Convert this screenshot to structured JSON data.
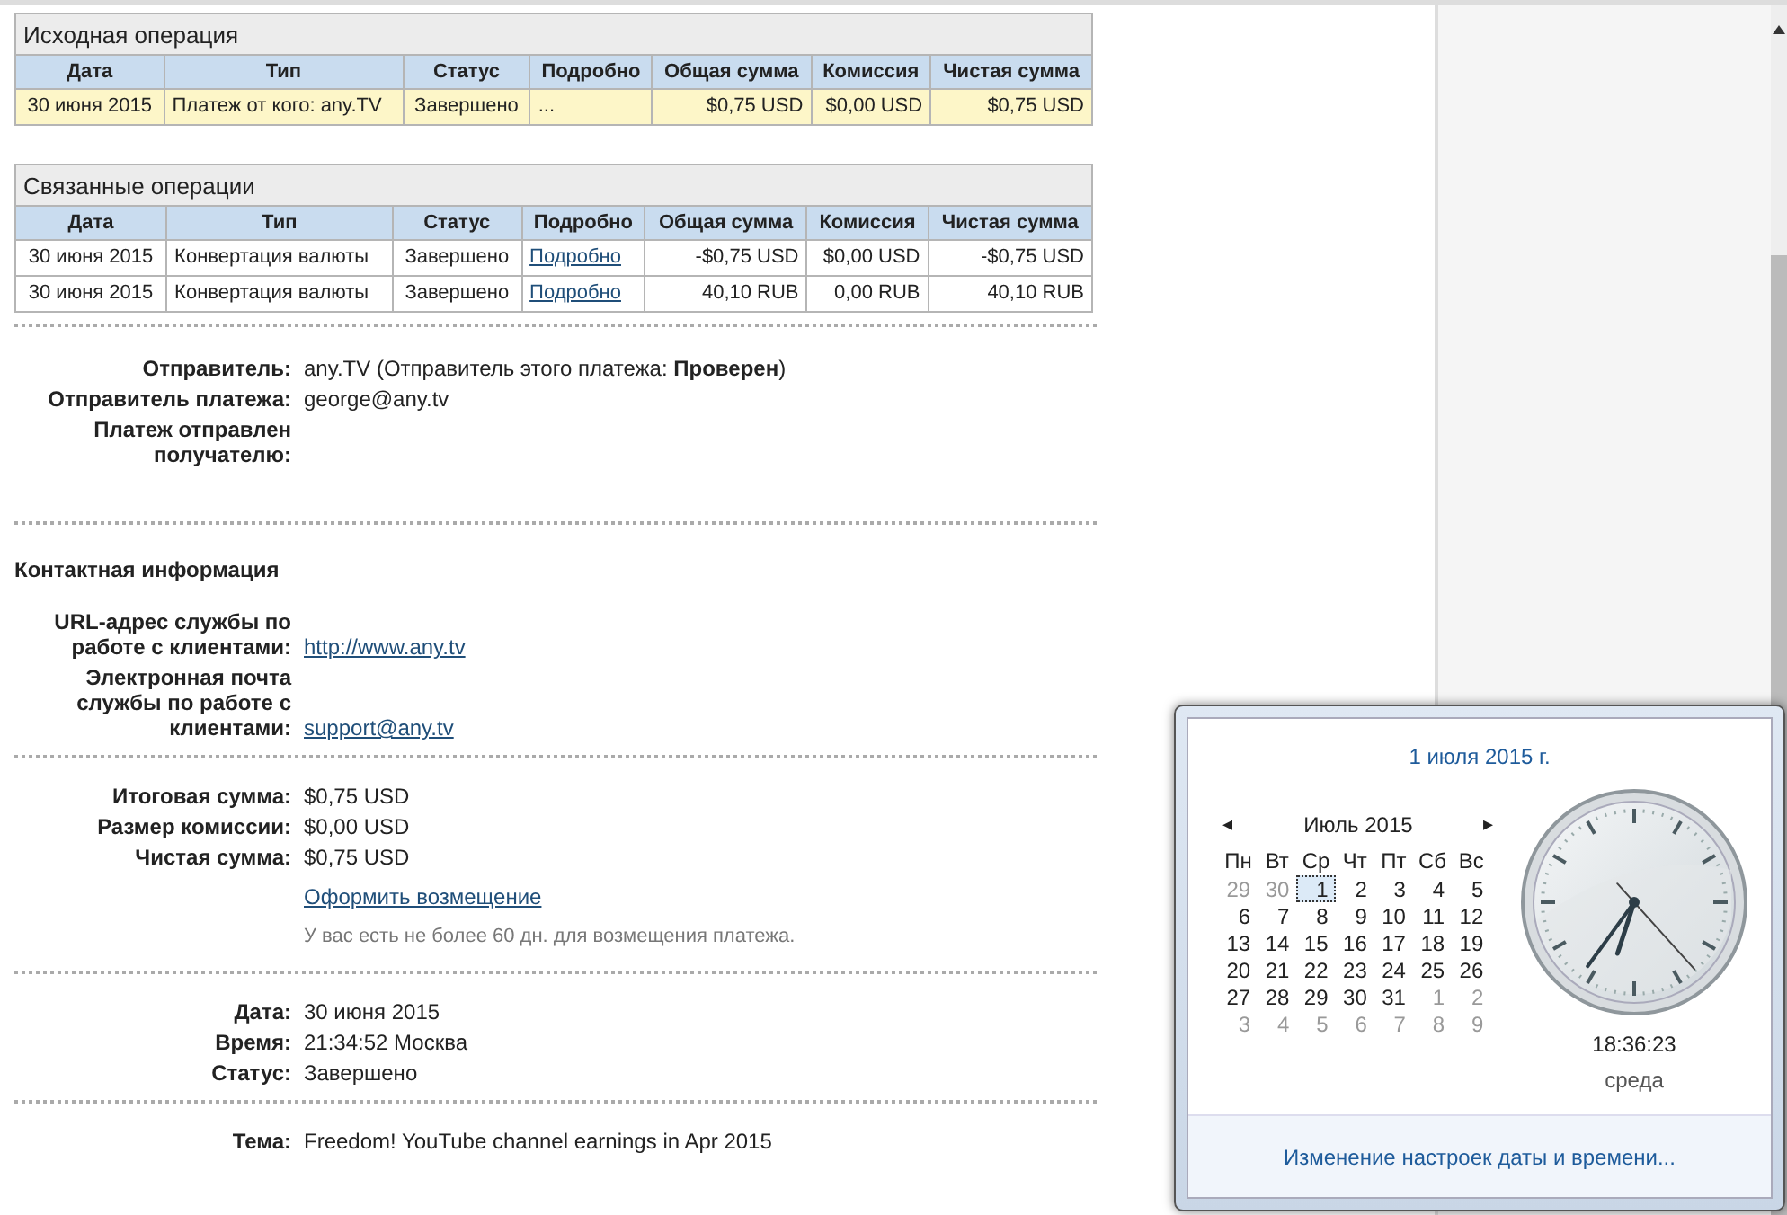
{
  "original_operation": {
    "title": "Исходная операция",
    "columns": [
      "Дата",
      "Тип",
      "Статус",
      "Подробно",
      "Общая сумма",
      "Комиссия",
      "Чистая сумма"
    ],
    "rows": [
      {
        "highlighted": true,
        "details_link": false,
        "cells": [
          "30 июня 2015",
          "Платеж от кого: any.TV",
          "Завершено",
          "...",
          "$0,75 USD",
          "$0,00 USD",
          "$0,75 USD"
        ]
      }
    ]
  },
  "related_operations": {
    "title": "Связанные операции",
    "columns": [
      "Дата",
      "Тип",
      "Статус",
      "Подробно",
      "Общая сумма",
      "Комиссия",
      "Чистая сумма"
    ],
    "rows": [
      {
        "highlighted": false,
        "details_link": true,
        "cells": [
          "30 июня 2015",
          "Конвертация валюты",
          "Завершено",
          "Подробно",
          "-$0,75 USD",
          "$0,00 USD",
          "-$0,75 USD"
        ]
      },
      {
        "highlighted": false,
        "details_link": true,
        "cells": [
          "30 июня 2015",
          "Конвертация валюты",
          "Завершено",
          "Подробно",
          "40,10 RUB",
          "0,00 RUB",
          "40,10 RUB"
        ]
      }
    ]
  },
  "sections": [
    {
      "fields": [
        {
          "kind": "text",
          "label": "Отправитель:",
          "value": "any.TV (Отправитель этого платежа: **Проверен**)"
        },
        {
          "kind": "text",
          "label": "Отправитель платежа:",
          "value": "george@any.tv"
        },
        {
          "kind": "text",
          "label": "Платеж отправлен получателю:"
        }
      ]
    },
    {
      "heading": "Контактная информация",
      "fields": [
        {
          "kind": "link",
          "label": "URL-адрес службы по работе с клиентами:",
          "value": "http://www.any.tv"
        },
        {
          "kind": "link",
          "label": "Электронная почта службы по работе с клиентами:",
          "value": "support@any.tv"
        }
      ]
    },
    {
      "fields": [
        {
          "kind": "text",
          "label": "Итоговая сумма:",
          "value": "$0,75 USD"
        },
        {
          "kind": "text",
          "label": "Размер комиссии:",
          "value": "$0,00 USD"
        },
        {
          "kind": "text",
          "label": "Чистая сумма:",
          "value": "$0,75 USD"
        },
        {
          "kind": "action",
          "value": "Оформить возмещение"
        },
        {
          "kind": "note",
          "value": "У вас есть не более 60 дн. для возмещения платежа."
        }
      ]
    },
    {
      "fields": [
        {
          "kind": "text",
          "label": "Дата:",
          "value": "30 июня 2015"
        },
        {
          "kind": "text",
          "label": "Время:",
          "value": "21:34:52 Москва"
        },
        {
          "kind": "text",
          "label": "Статус:",
          "value": "Завершено"
        }
      ]
    },
    {
      "fields": [
        {
          "kind": "text",
          "label": "Тема:",
          "value": "Freedom! YouTube channel earnings in Apr 2015"
        }
      ]
    }
  ],
  "calendar_popup": {
    "date_heading": "1 июля 2015 г.",
    "prev": "◂",
    "month": "Июль 2015",
    "next": "▸",
    "weekdays": [
      "Пн",
      "Вт",
      "Ср",
      "Чт",
      "Пт",
      "Сб",
      "Вс"
    ],
    "weeks": [
      [
        {
          "day": "29",
          "other_month": true,
          "selected": false
        },
        {
          "day": "30",
          "other_month": true,
          "selected": false
        },
        {
          "day": "1",
          "other_month": false,
          "selected": true
        },
        {
          "day": "2",
          "other_month": false,
          "selected": false
        },
        {
          "day": "3",
          "other_month": false,
          "selected": false
        },
        {
          "day": "4",
          "other_month": false,
          "selected": false
        },
        {
          "day": "5",
          "other_month": false,
          "selected": false
        }
      ],
      [
        {
          "day": "6",
          "other_month": false,
          "selected": false
        },
        {
          "day": "7",
          "other_month": false,
          "selected": false
        },
        {
          "day": "8",
          "other_month": false,
          "selected": false
        },
        {
          "day": "9",
          "other_month": false,
          "selected": false
        },
        {
          "day": "10",
          "other_month": false,
          "selected": false
        },
        {
          "day": "11",
          "other_month": false,
          "selected": false
        },
        {
          "day": "12",
          "other_month": false,
          "selected": false
        }
      ],
      [
        {
          "day": "13",
          "other_month": false,
          "selected": false
        },
        {
          "day": "14",
          "other_month": false,
          "selected": false
        },
        {
          "day": "15",
          "other_month": false,
          "selected": false
        },
        {
          "day": "16",
          "other_month": false,
          "selected": false
        },
        {
          "day": "17",
          "other_month": false,
          "selected": false
        },
        {
          "day": "18",
          "other_month": false,
          "selected": false
        },
        {
          "day": "19",
          "other_month": false,
          "selected": false
        }
      ],
      [
        {
          "day": "20",
          "other_month": false,
          "selected": false
        },
        {
          "day": "21",
          "other_month": false,
          "selected": false
        },
        {
          "day": "22",
          "other_month": false,
          "selected": false
        },
        {
          "day": "23",
          "other_month": false,
          "selected": false
        },
        {
          "day": "24",
          "other_month": false,
          "selected": false
        },
        {
          "day": "25",
          "other_month": false,
          "selected": false
        },
        {
          "day": "26",
          "other_month": false,
          "selected": false
        }
      ],
      [
        {
          "day": "27",
          "other_month": false,
          "selected": false
        },
        {
          "day": "28",
          "other_month": false,
          "selected": false
        },
        {
          "day": "29",
          "other_month": false,
          "selected": false
        },
        {
          "day": "30",
          "other_month": false,
          "selected": false
        },
        {
          "day": "31",
          "other_month": false,
          "selected": false
        },
        {
          "day": "1",
          "other_month": true,
          "selected": false
        },
        {
          "day": "2",
          "other_month": true,
          "selected": false
        }
      ],
      [
        {
          "day": "3",
          "other_month": true,
          "selected": false
        },
        {
          "day": "4",
          "other_month": true,
          "selected": false
        },
        {
          "day": "5",
          "other_month": true,
          "selected": false
        },
        {
          "day": "6",
          "other_month": true,
          "selected": false
        },
        {
          "day": "7",
          "other_month": true,
          "selected": false
        },
        {
          "day": "8",
          "other_month": true,
          "selected": false
        },
        {
          "day": "9",
          "other_month": true,
          "selected": false
        }
      ]
    ],
    "time": "18:36:23",
    "weekday": "среда",
    "settings_link": "Изменение настроек даты и времени..."
  }
}
